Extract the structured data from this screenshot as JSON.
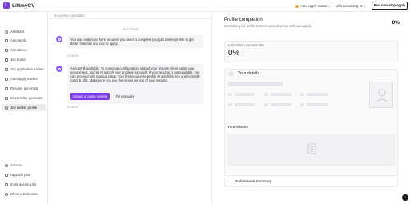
{
  "app": {
    "name": "LiftmyCV",
    "logo_letter": "L"
  },
  "topbar": {
    "autoapply_status": "Auto-apply status",
    "limits_remaining": "Lifts remaining:",
    "limits_count": "2",
    "run_button": "Run non-stop apply",
    "status_color": "#f0a020"
  },
  "sidebar": {
    "items": [
      {
        "label": "Assistant",
        "icon": "assistant-icon"
      },
      {
        "label": "Auto apply",
        "icon": "lightning-icon"
      },
      {
        "label": "AI matches",
        "icon": "sparkle-icon"
      },
      {
        "label": "Job board",
        "icon": "briefcase-icon"
      },
      {
        "label": "Job application tracker",
        "icon": "tracker-icon"
      },
      {
        "label": "Auto-apply tracker",
        "icon": "tracker-icon"
      },
      {
        "label": "Resume generator",
        "icon": "document-icon"
      },
      {
        "label": "Cover letter generator",
        "icon": "letter-icon"
      },
      {
        "label": "Job seeker profile",
        "icon": "user-icon"
      }
    ],
    "bottom_items": [
      {
        "label": "Account",
        "icon": "user-icon"
      },
      {
        "label": "Upgrade plan",
        "icon": "upgrade-icon"
      },
      {
        "label": "Invite & earn Lifts",
        "icon": "gift-icon"
      },
      {
        "label": "Chrome Extension",
        "icon": "chrome-icon"
      }
    ]
  },
  "chat": {
    "header": "No profiles available",
    "date": "05.07.2025",
    "messages": [
      {
        "text": "You was redirected here because you need to complete your job seeker profile to get better matches and use AI apply.",
        "time": "22:36:09"
      },
      {
        "text": "AI AutoFill available. To speed up configuration, upload your resume file or paste your resume text, and let AI autofill your profile in seconds. If your resume is not available, you can proceed with manual setup. Your first resume-to-profile AI autofill is free and normally costs 5 Lifts. Make sure you use the recent version of your resume.",
        "time": "22:36:11"
      }
    ],
    "upload_button": "Upload or paste resume",
    "fill_button": "Fill manually"
  },
  "profile": {
    "title": "Profile completion",
    "subtitle": "Complete your profile to boost your chances with auto apply",
    "completion": "0%",
    "success_rate_label": "Automation success rate",
    "success_rate": "0%",
    "details_title": "Your details",
    "resume_title": "Your resume",
    "summary_title": "Professional Summary"
  },
  "accent_color": "#7c3aed"
}
